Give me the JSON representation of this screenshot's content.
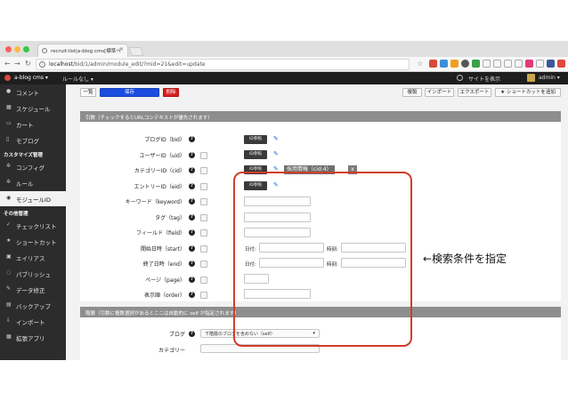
{
  "browser": {
    "tab_title": "recruit-list|a-blog cms[標準ペ",
    "tab_close": "×",
    "url_host": "localhost",
    "url_path": "/bid/1/admin/module_edit/?mid=21&edit=update"
  },
  "appbar": {
    "brand": "a-blog cms ▾",
    "rule_menu": "ルールなし ▾",
    "view_site": "サイトを表示",
    "admin": "admin ▾"
  },
  "sidebar": {
    "items_top": [
      "コメント",
      "スケジュール",
      "カート",
      "モブログ"
    ],
    "section_customize": "カスタマイズ管理",
    "items_customize": [
      "コンフィグ",
      "ルール",
      "モジュールID"
    ],
    "section_other": "その他管理",
    "items_other": [
      "チェックリスト",
      "ショートカット",
      "エイリアス",
      "パブリッシュ",
      "データ修正",
      "バックアップ",
      "インポート",
      "拡張アプリ"
    ]
  },
  "toolbar": {
    "list": "一覧",
    "save": "保存",
    "delete": "削除",
    "duplicate": "複製",
    "import": "インポート",
    "export": "エクスポート",
    "shortcut": "ショートカットを追加"
  },
  "args_panel": {
    "heading": "引数（チェックするとURLコンテキストが優先されます）",
    "fields": [
      {
        "label": "ブログID（bid）"
      },
      {
        "label": "ユーザーID（uid）"
      },
      {
        "label": "カテゴリーID（cid）"
      },
      {
        "label": "エントリーID（eid）"
      },
      {
        "label": "キーワード（keyword）"
      },
      {
        "label": "タグ（tag）"
      },
      {
        "label": "フィールド（field）"
      },
      {
        "label": "開始日時（start）"
      },
      {
        "label": "終了日時（end）"
      },
      {
        "label": "ページ（page）"
      },
      {
        "label": "表示順（order）"
      }
    ],
    "id_ref": "ID参照",
    "qmark": "?",
    "cid_tag": "採用情報（cid:4）",
    "cid_tag_remove": "x",
    "date_label": "日付:",
    "time_label": "時刻:"
  },
  "annotation": "←検索条件を指定",
  "scope_panel": {
    "heading": "階層（引数に複数選択があるとここは自動的に self が指定されます）",
    "blog_label": "ブログ",
    "blog_value": "下階層のブログを含めない（self）",
    "category_label": "カテゴリー"
  }
}
